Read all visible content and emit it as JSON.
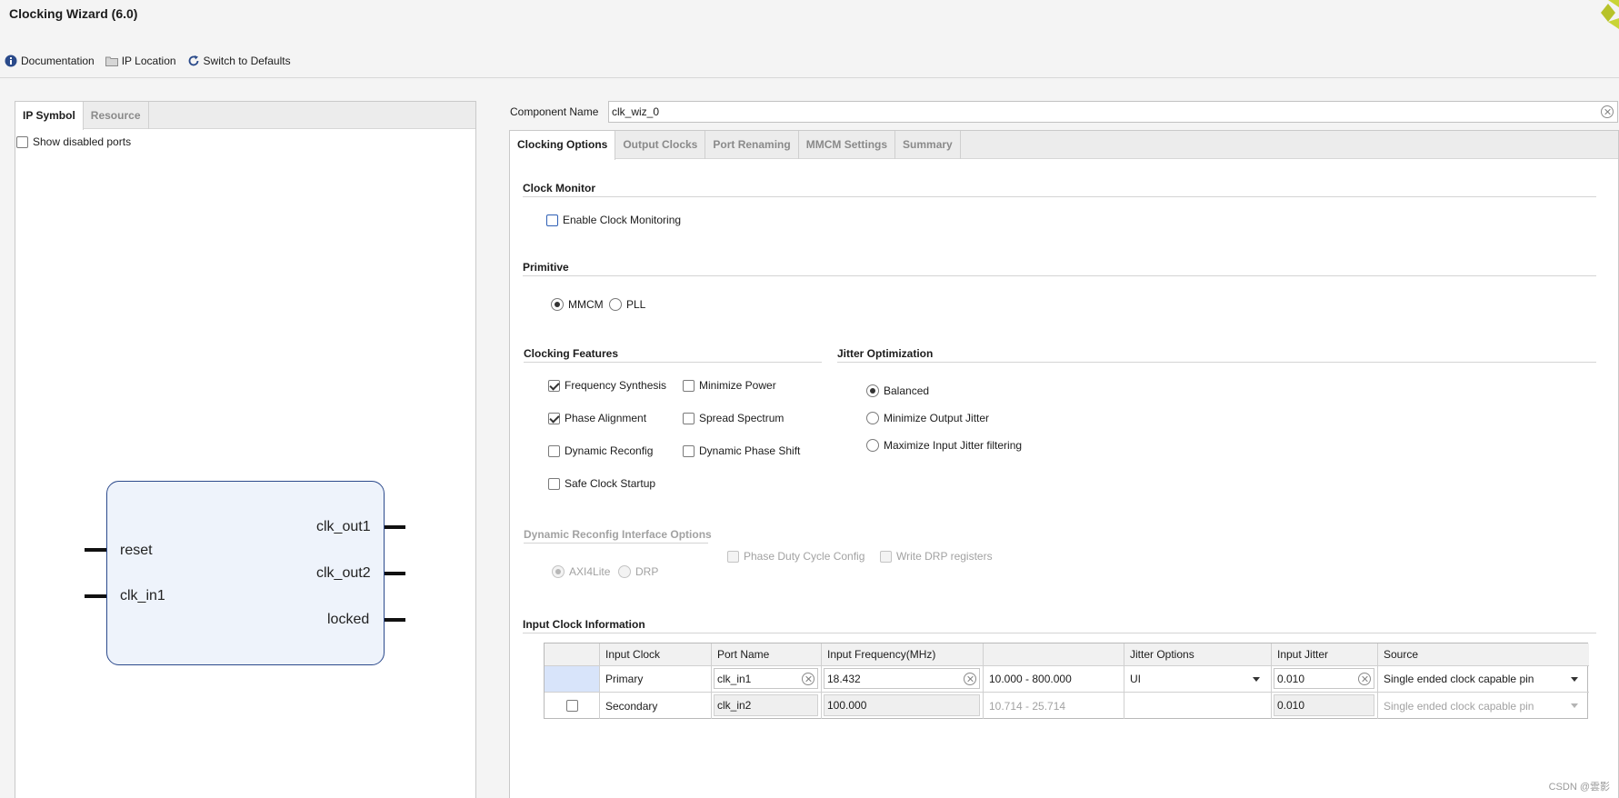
{
  "window": {
    "title": "Clocking Wizard (6.0)"
  },
  "toolbar": {
    "documentation": "Documentation",
    "ip_location": "IP Location",
    "switch_defaults": "Switch to Defaults"
  },
  "left_panel": {
    "tabs": [
      "IP Symbol",
      "Resource"
    ],
    "show_disabled_ports": "Show disabled ports",
    "symbol": {
      "inputs": [
        "reset",
        "clk_in1"
      ],
      "outputs": [
        "clk_out1",
        "clk_out2",
        "locked"
      ]
    }
  },
  "component": {
    "label": "Component Name",
    "value": "clk_wiz_0"
  },
  "tabs": [
    "Clocking Options",
    "Output Clocks",
    "Port Renaming",
    "MMCM Settings",
    "Summary"
  ],
  "clock_monitor": {
    "title": "Clock Monitor",
    "enable_label": "Enable Clock Monitoring",
    "enabled": false
  },
  "primitive": {
    "title": "Primitive",
    "options": [
      "MMCM",
      "PLL"
    ],
    "selected": "MMCM"
  },
  "clocking_features": {
    "title": "Clocking Features",
    "items": [
      {
        "label": "Frequency Synthesis",
        "checked": true
      },
      {
        "label": "Minimize Power",
        "checked": false
      },
      {
        "label": "Phase Alignment",
        "checked": true
      },
      {
        "label": "Spread Spectrum",
        "checked": false
      },
      {
        "label": "Dynamic Reconfig",
        "checked": false
      },
      {
        "label": "Dynamic Phase Shift",
        "checked": false
      },
      {
        "label": "Safe Clock Startup",
        "checked": false
      }
    ]
  },
  "jitter_optimization": {
    "title": "Jitter Optimization",
    "options": [
      "Balanced",
      "Minimize Output Jitter",
      "Maximize Input Jitter filtering"
    ],
    "selected": "Balanced"
  },
  "dynamic_reconfig": {
    "title": "Dynamic Reconfig Interface Options",
    "interface_options": [
      "AXI4Lite",
      "DRP"
    ],
    "selected": "AXI4Lite",
    "phase_duty_label": "Phase Duty Cycle Config",
    "write_drp_label": "Write DRP registers"
  },
  "input_clock_info": {
    "title": "Input Clock Information",
    "headers": [
      "",
      "Input Clock",
      "Port Name",
      "Input Frequency(MHz)",
      "",
      "Jitter Options",
      "Input Jitter",
      "Source"
    ],
    "rows": [
      {
        "input_clock": "Primary",
        "port_name": "clk_in1",
        "frequency": "18.432",
        "range": "10.000 - 800.000",
        "jitter_option": "UI",
        "input_jitter": "0.010",
        "source": "Single ended clock capable pin"
      },
      {
        "input_clock": "Secondary",
        "port_name": "clk_in2",
        "frequency": "100.000",
        "range": "10.714 - 25.714",
        "jitter_option": "",
        "input_jitter": "0.010",
        "source": "Single ended clock capable pin"
      }
    ]
  },
  "watermark": "CSDN @雲影",
  "colors": {
    "accent_blue": "#2e5fb5",
    "symbol_fill": "#eef3fb",
    "logo": "#c9d437"
  }
}
